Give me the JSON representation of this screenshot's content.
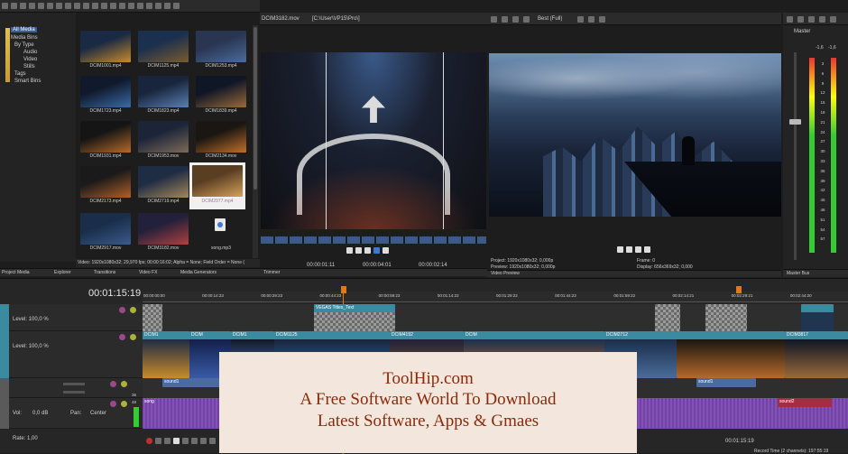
{
  "explorer": {
    "tree": [
      "All Media",
      "Media Bins",
      "By Type",
      "Audio",
      "Video",
      "Stills",
      "Tags",
      "Smart Bins"
    ],
    "status": "Video: 1920x1080x32; 29,970 fps; 00:00:16:02; Alpha = None; Field Order = None (",
    "tabs": [
      "Project Media",
      "Explorer",
      "Transitions",
      "Video FX",
      "Media Generators"
    ]
  },
  "media": [
    {
      "name": "DCIM1001.mp4",
      "c1": "#1a2a44",
      "c2": "#c88b2a"
    },
    {
      "name": "DCIM1125.mp4",
      "c1": "#1b2f4e",
      "c2": "#7a5b30"
    },
    {
      "name": "DCIM1253.mp4",
      "c1": "#2a3552",
      "c2": "#4a6c9a"
    },
    {
      "name": "DCIM1723.mp4",
      "c1": "#101a2c",
      "c2": "#3a6aa8"
    },
    {
      "name": "DCIM1823.mp4",
      "c1": "#18253c",
      "c2": "#5a7fb4"
    },
    {
      "name": "DCIM1839.mp4",
      "c1": "#0f1626",
      "c2": "#9a6a3a"
    },
    {
      "name": "DCIM1931.mp4",
      "c1": "#151515",
      "c2": "#b56a2a"
    },
    {
      "name": "DCIM1953.mov",
      "c1": "#1c2538",
      "c2": "#7e6a5a"
    },
    {
      "name": "DCIM2134.mov",
      "c1": "#1a1612",
      "c2": "#c0702a"
    },
    {
      "name": "DCIM2173.mp4",
      "c1": "#1a1a1a",
      "c2": "#b0602a"
    },
    {
      "name": "DCIM2719.mp4",
      "c1": "#1e2c44",
      "c2": "#a4875a"
    },
    {
      "name": "DCIM2977.mp4",
      "c1": "#5a3e22",
      "c2": "#d4a25a"
    },
    {
      "name": "DCIM2917.mov",
      "c1": "#1a2e4a",
      "c2": "#3a5a8a"
    },
    {
      "name": "DCIM3182.mov",
      "c1": "#22203a",
      "c2": "#b04040"
    },
    {
      "name": "song.mp3",
      "c1": "#2b2b2b",
      "c2": "#2b2b2b"
    }
  ],
  "trimmer": {
    "title": "DCIM3182.mov",
    "path": "[C:\\User\\VP15\\Pro\\]",
    "tc_start": "00:00:01:11",
    "tc_dur": "00:00:04:01",
    "tc_end": "00:00:02:14",
    "tab": "Trimmer"
  },
  "preview": {
    "quality": "Best (Full)",
    "project": "Project:  1920x1080x32; 0,000p",
    "preview": "Preview: 1920x1080x32; 0,000p",
    "frame": "Frame:        0",
    "display": "Display:     656x369x32; 0,000",
    "tab": "Video Preview"
  },
  "master": {
    "label": "Master",
    "levels": [
      "-1,6",
      "-1,6"
    ],
    "scale": [
      "3",
      "6",
      "9",
      "12",
      "15",
      "18",
      "21",
      "24",
      "27",
      "30",
      "33",
      "36",
      "39",
      "42",
      "45",
      "48",
      "51",
      "54",
      "57"
    ],
    "tab": "Master Bus"
  },
  "timeline": {
    "timecode": "00:01:15:19",
    "ruler": [
      "00:00:00:00",
      "00:00:14:23",
      "00:00:29:23",
      "00:00:44:23",
      "00:00:59:23",
      "00:01:14:22",
      "00:01:29:22",
      "00:01:44:22",
      "00:01:59:22",
      "00:02:14:21",
      "00:02:29:21",
      "00:02:44:20"
    ],
    "level1": "Level: 100,0 %",
    "level2": "Level: 100,0 %",
    "vol": "Vol:",
    "vol_val": "0,0 dB",
    "pan": "Pan:",
    "pan_val": "Center",
    "rate": "Rate: 1,00",
    "end_time": "00:01:15:19",
    "record": "Record Time (2 channels): 197:55:19",
    "clips_title": [
      "VEGAS Titles_Text"
    ],
    "clips_video": [
      "DCIM1",
      "DCIM",
      "DCIM1",
      "DCIM1125",
      "DCIM4192",
      "DCIM",
      "DCIM2712",
      "DCIM3817"
    ],
    "audio1": [
      "sound1",
      "sound1"
    ],
    "audio2": [
      "song",
      "sound2"
    ],
    "meter_vals": [
      "36",
      "48"
    ]
  },
  "overlay": {
    "line1": "ToolHip.com",
    "line2": "A Free Software World To Download",
    "line3": "Latest Software, Apps & Gmaes"
  }
}
